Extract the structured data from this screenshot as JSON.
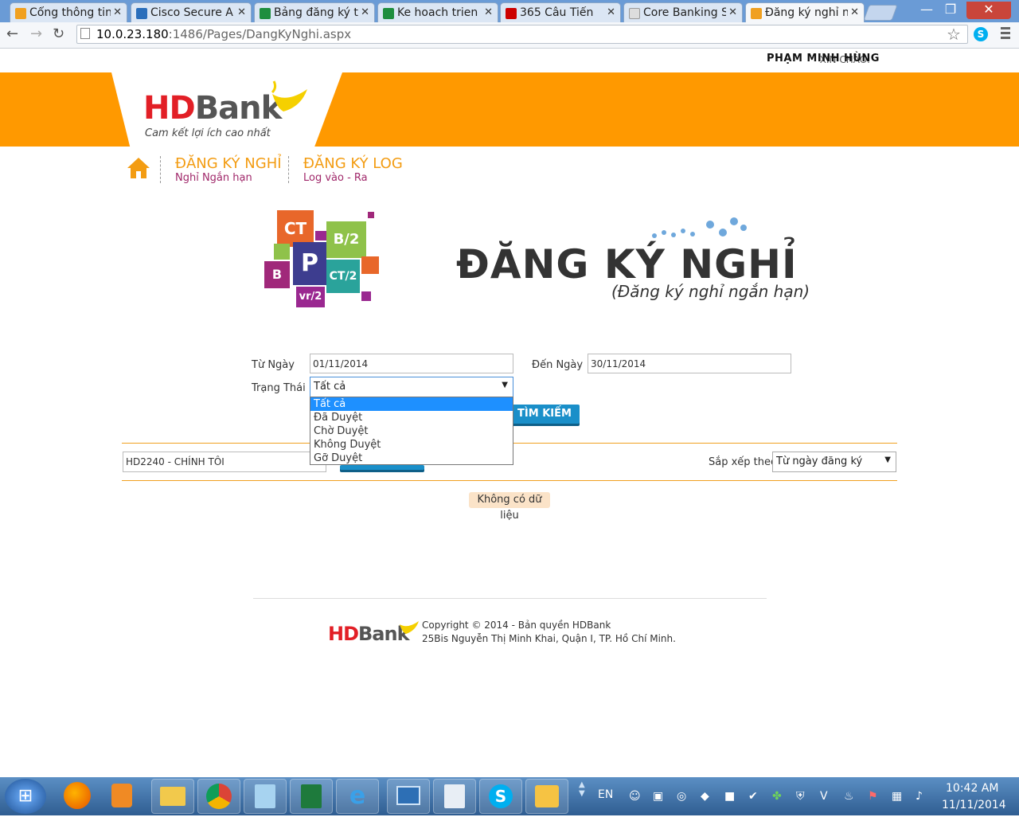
{
  "browser": {
    "tabs": [
      {
        "title": "Cổng thông tin",
        "color": "#f0a020"
      },
      {
        "title": "Cisco Secure A",
        "color": "#2a6ebb"
      },
      {
        "title": "Bảng đăng ký t",
        "color": "#1e8e3e"
      },
      {
        "title": "Ke hoach trien",
        "color": "#1e8e3e"
      },
      {
        "title": "365 Câu Tiến",
        "color": "#cc0000"
      },
      {
        "title": "Core Banking S",
        "color": "#dddddd"
      },
      {
        "title": "Đăng ký nghỉ n",
        "color": "#f0a020"
      }
    ],
    "url_host": "10.0.23.180",
    "url_path": ":1486/Pages/DangKyNghi.aspx",
    "window_buttons": {
      "minimize": "—",
      "restore": "❐",
      "close": "✕"
    },
    "nav_icons": {
      "back": "←",
      "forward": "→",
      "reload": "↻",
      "star": "☆"
    }
  },
  "header": {
    "greeting_label": "XIN CHÀO:",
    "user_name": "PHẠM MINH HÙNG",
    "logo_hd": "HD",
    "logo_bank": "Bank",
    "slogan": "Cam kết lợi ích cao nhất"
  },
  "nav": {
    "home_icon": "home-icon",
    "items": [
      {
        "title": "ĐĂNG KÝ NGHỈ",
        "subtitle": "Nghỉ Ngắn hạn"
      },
      {
        "title": "ĐĂNG KÝ LOG",
        "subtitle": "Log vào - Ra"
      }
    ]
  },
  "hero": {
    "tiles": [
      "CT",
      "B/2",
      "P",
      "CT/2",
      "B",
      "vr/2"
    ],
    "title": "ĐĂNG KÝ NGHỈ",
    "subtitle": "(Đăng ký nghỉ ngắn hạn)"
  },
  "form": {
    "from_label": "Từ Ngày",
    "from_value": "01/11/2014",
    "to_label": "Đến Ngày",
    "to_value": "30/11/2014",
    "status_label": "Trạng Thái",
    "status_value": "Tất cả",
    "status_options": [
      "Tất cả",
      "Đã Duyệt",
      "Chờ Duyệt",
      "Không Duyệt",
      "Gỡ Duyệt"
    ],
    "search_button": "TÌM KIẾM"
  },
  "filter": {
    "employee_value": "HD2240 - CHÍNH TÔI",
    "sort_label": "Sắp xếp theo",
    "sort_value": "Từ ngày đăng ký"
  },
  "results": {
    "empty_message": "Không có dữ liệu"
  },
  "footer": {
    "logo_hd": "HD",
    "logo_bank": "Bank",
    "copyright": "Copyright © 2014 - Bản quyền HDBank",
    "address": "25Bis Nguyễn Thị Minh Khai, Quận I, TP. Hồ Chí Minh."
  },
  "taskbar": {
    "language": "EN",
    "time": "10:42 AM",
    "date": "11/11/2014"
  }
}
